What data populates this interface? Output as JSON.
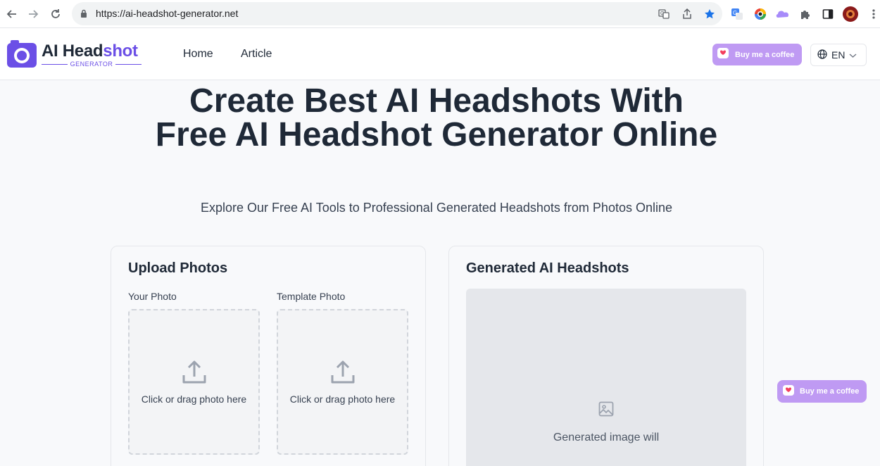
{
  "browser": {
    "url": "https://ai-headshot-generator.net",
    "icons": [
      "back-icon",
      "forward-icon",
      "reload-icon",
      "lock-icon",
      "translate-icon",
      "share-icon",
      "bookmark-star-icon",
      "google-translate-extension-icon",
      "color-picker-extension-icon",
      "cloud-extension-icon",
      "extensions-puzzle-icon",
      "sidepanel-icon",
      "profile-avatar-icon",
      "more-menu-icon"
    ]
  },
  "header": {
    "logo_primary": "AI Head",
    "logo_accent": "shot",
    "logo_sub": "GENERATOR",
    "nav": [
      "Home",
      "Article"
    ],
    "coffee_label": "Buy me a coffee",
    "lang_label": "EN",
    "colors": {
      "brand": "#6b4fe6",
      "coffee": "#bf9af3"
    }
  },
  "hero": {
    "title": "Create Best AI Headshots With Free AI Headshot Generator Online",
    "subtitle": "Explore Our Free AI Tools to Professional Generated Headshots from Photos Online"
  },
  "upload": {
    "title": "Upload Photos",
    "your_photo_label": "Your Photo",
    "template_photo_label": "Template Photo",
    "dropzone_text": "Click or drag photo here"
  },
  "generated": {
    "title": "Generated AI Headshots",
    "placeholder_text": "Generated image will"
  },
  "floating": {
    "coffee_label": "Buy me a coffee"
  }
}
